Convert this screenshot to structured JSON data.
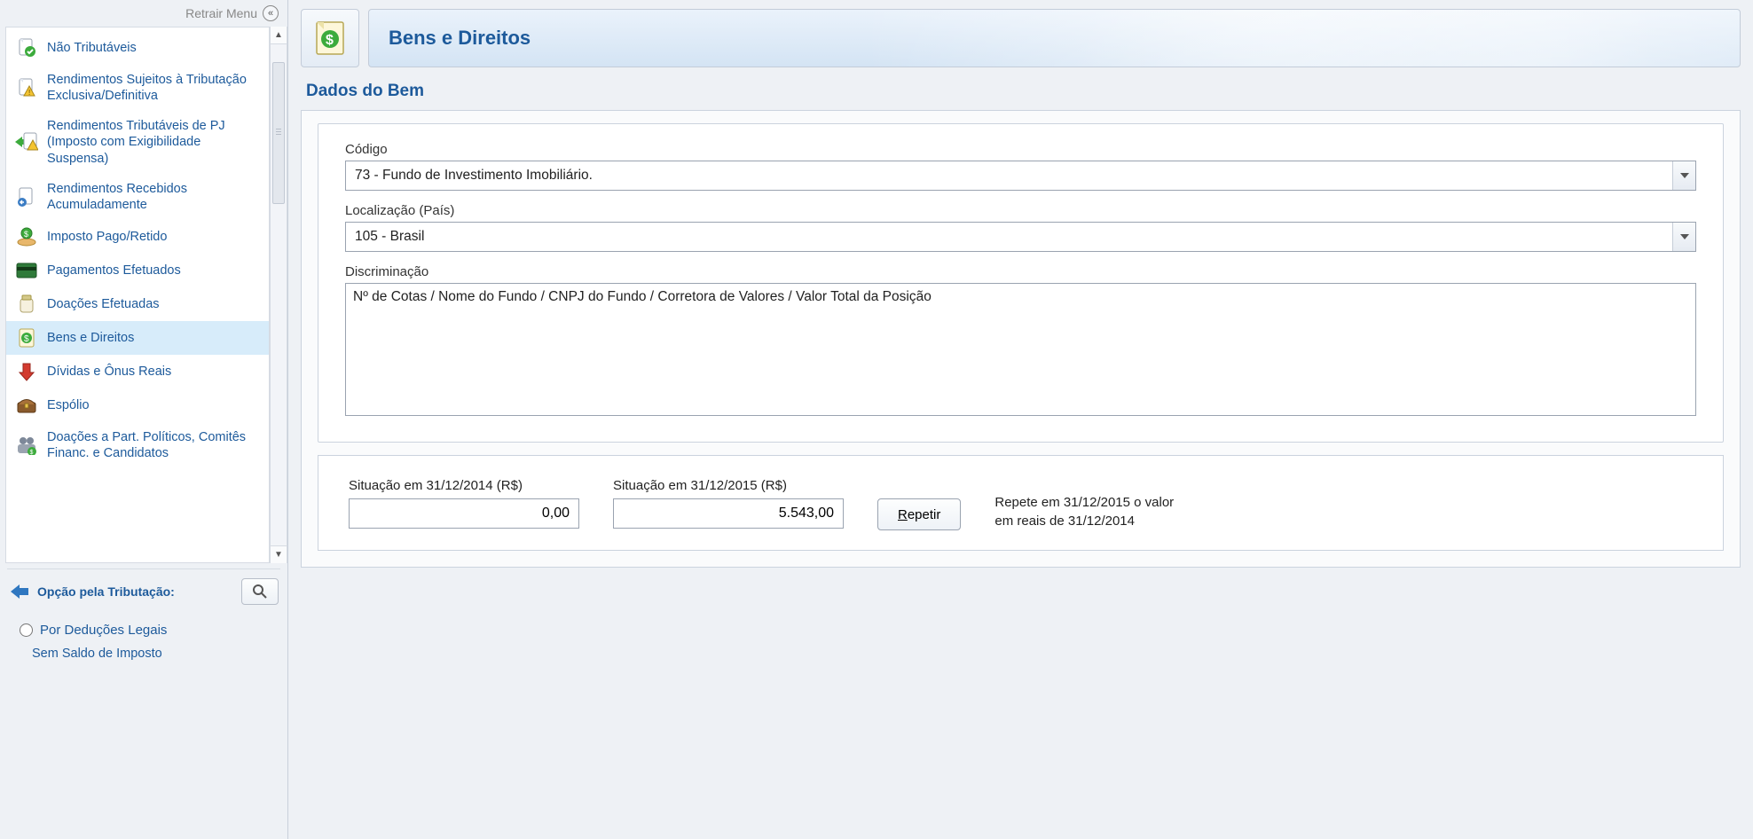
{
  "retrair_label": "Retrair Menu",
  "sidebar": {
    "items": [
      {
        "label": "Não Tributáveis",
        "icon": "doc-check"
      },
      {
        "label": "Rendimentos Sujeitos à Tributação Exclusiva/Definitiva",
        "icon": "doc-warn"
      },
      {
        "label": "Rendimentos Tributáveis de PJ (Imposto com Exigibilidade Suspensa)",
        "icon": "doc-warn-left"
      },
      {
        "label": "Rendimentos Recebidos Acumuladamente",
        "icon": "doc-left"
      },
      {
        "label": "Imposto Pago/Retido",
        "icon": "hand-coin"
      },
      {
        "label": "Pagamentos Efetuados",
        "icon": "card"
      },
      {
        "label": "Doações Efetuadas",
        "icon": "jar"
      },
      {
        "label": "Bens e Direitos",
        "icon": "money-doc"
      },
      {
        "label": "Dívidas e Ônus Reais",
        "icon": "down-arrow"
      },
      {
        "label": "Espólio",
        "icon": "chest"
      },
      {
        "label": "Doações a Part. Políticos, Comitês Financ. e Candidatos",
        "icon": "people"
      }
    ],
    "selected_index": 7
  },
  "opcao_label": "Opção pela Tributação:",
  "radio_label": "Por Deduções Legais",
  "sem_saldo_label": "Sem Saldo de Imposto",
  "header_title": "Bens e Direitos",
  "section_title": "Dados do Bem",
  "form": {
    "codigo_label": "Código",
    "codigo_value": "73 - Fundo de Investimento Imobiliário.",
    "local_label": "Localização (País)",
    "local_value": "105 - Brasil",
    "discrim_label": "Discriminação",
    "discrim_value": "Nº de Cotas / Nome do Fundo / CNPJ do Fundo / Corretora de Valores / Valor Total da Posição"
  },
  "situacao": {
    "label_2014": "Situação em 31/12/2014 (R$)",
    "val_2014": "0,00",
    "label_2015": "Situação em 31/12/2015 (R$)",
    "val_2015": "5.543,00",
    "repetir_label_underline": "R",
    "repetir_label_rest": "epetir",
    "repete_text_l1": "Repete em 31/12/2015 o valor",
    "repete_text_l2": "em reais de 31/12/2014"
  }
}
